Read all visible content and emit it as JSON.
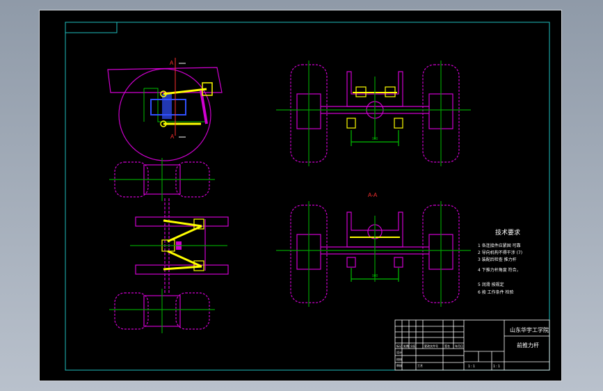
{
  "colors": {
    "background": "#000000",
    "frame": "#20c0c0",
    "tire": "#d000d0",
    "centerline": "#00a000",
    "axle": "#ff30ff",
    "link": "#ffff00",
    "dimension": "#00c000",
    "text": "#ffffff",
    "section": "#ff3030"
  },
  "drawing": {
    "section_label": "A-A",
    "marker_a_top": "A",
    "marker_a_bottom": "A",
    "tech_title": "技术要求",
    "tech_notes": [
      "1 各连接件应紧固 可靠",
      "2 导向机构不得干涉 (7)",
      "3 装配后检查 推力杆",
      "4 下推力杆角度 符合，",
      "5 润滑 按规定",
      "6 按 工作条件 检验"
    ],
    "dim_top": "900",
    "dim_bottom": "900"
  },
  "title_block": {
    "school": "山东华宇工学院",
    "part_name": "前推力杆",
    "scale_label": "1 : 1",
    "sheet_label": "1 : 1",
    "row_labels": [
      "设计",
      "校核",
      "审核",
      "工艺"
    ],
    "header_labels": [
      "标记",
      "处数",
      "分区",
      "更改文件号",
      "签名",
      "年月日"
    ]
  }
}
